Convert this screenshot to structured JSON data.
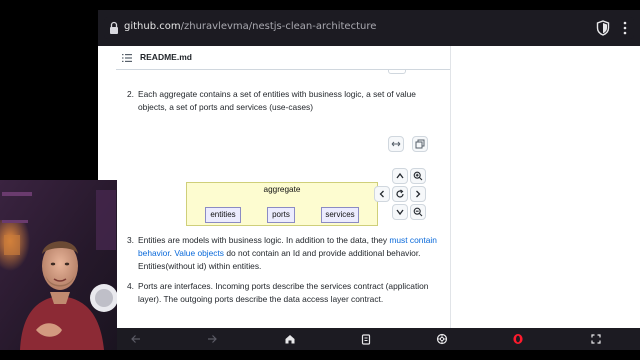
{
  "browser": {
    "url_host": "github.com",
    "url_path": "/zhuravlevma/nestjs-clean-architecture"
  },
  "readme": {
    "title": "README.md"
  },
  "content": {
    "item2": {
      "number": "2.",
      "text": "Each aggregate contains a set of entities with business logic, a set of value objects, a set of ports and services (use-cases)"
    },
    "diagram": {
      "title": "aggregate",
      "boxes": [
        "entities",
        "ports",
        "services"
      ]
    },
    "item3": {
      "number": "3.",
      "text_a": "Entities are models with business logic. In addition to the data, they ",
      "link_a": "must contain behavior",
      "text_b": ". ",
      "link_b": "Value objects",
      "text_c": " do not contain an Id and provide additional behavior. Entities(without id) within entities."
    },
    "item4": {
      "number": "4.",
      "text": "Ports are interfaces. Incoming ports describe the services contract (application layer). The outgoing ports describe the data access layer contract."
    }
  },
  "icons": {
    "lock": "lock-icon",
    "shield": "shield-icon",
    "menu": "kebab-menu-icon",
    "list": "list-icon",
    "expand": "expand-icon",
    "copy": "copy-icon",
    "zoom_in": "zoom-in-icon",
    "zoom_out": "zoom-out-icon",
    "pan_up": "chevron-up-icon",
    "pan_down": "chevron-down-icon",
    "pan_left": "chevron-left-icon",
    "pan_right": "chevron-right-icon",
    "reset": "reset-icon",
    "back": "back-arrow-icon",
    "forward": "forward-arrow-icon",
    "home": "home-icon",
    "tabs": "tabs-icon",
    "settings": "settings-icon",
    "opera": "opera-icon",
    "fullscreen": "fullscreen-icon"
  },
  "colors": {
    "link": "#0969da",
    "diagram_fill": "#fdfcd0",
    "box_fill": "#ececfe",
    "opera_red": "#ff1b2d"
  }
}
